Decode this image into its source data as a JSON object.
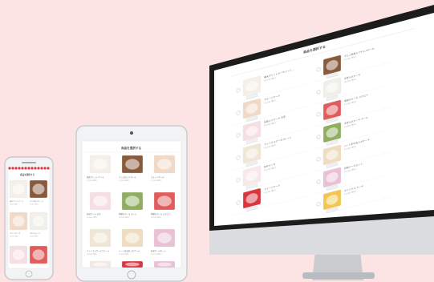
{
  "screen_title": "商品を選択する",
  "products": {
    "left": [
      {
        "name": "楽天プリントケーキラージ…",
        "price": "¥3,500 (税込)",
        "icon": "photo-cake-icon",
        "color": "#f4efe8"
      },
      {
        "name": "フルーツケーキ",
        "price": "¥3,200 (税込)",
        "icon": "fruit-cake-icon",
        "color": "#f0d9c6"
      },
      {
        "name": "名前入りケーキ 文字",
        "price": "¥3,000 (税込)",
        "icon": "letter-cake-icon",
        "color": "#f6dfe3"
      },
      {
        "name": "ファイナルケーキプレート",
        "price": "¥3,500 (税込)",
        "icon": "plate-cake-icon",
        "color": "#efe6d6"
      },
      {
        "name": "新作ケーキ",
        "price": "¥3,200 (税込)",
        "icon": "new-cake-icon",
        "color": "#f7e9e9"
      },
      {
        "name": "スイーツケーキ",
        "price": "¥3,500 (税込)",
        "icon": "rose-cake-icon",
        "color": "#d9363e"
      }
    ],
    "right": [
      {
        "name": "チョコ名前入りチョコケーキ",
        "price": "¥3,500 (税込)",
        "icon": "chocolate-cake-icon",
        "color": "#8a5a3c"
      },
      {
        "name": "文字入れケーキ",
        "price": "¥3,200 (税込)",
        "icon": "bear-cake-icon",
        "color": "#f1efe9"
      },
      {
        "name": "季節のケーキ スクエア",
        "price": "¥3,500 (税込)",
        "icon": "square-cake-icon",
        "color": "#e35c5c"
      },
      {
        "name": "文字入れケーキ ホール",
        "price": "¥3,500 (税込)",
        "icon": "frame-cake-icon",
        "color": "#8fae5f"
      },
      {
        "name": "ハート形の名入れケーキ",
        "price": "¥3,500 (税込)",
        "icon": "heart-cake-icon",
        "color": "#f0dcc0"
      },
      {
        "name": "名前ケーキセット",
        "price": "¥3,200 (税込)",
        "icon": "gift-box-icon",
        "color": "#e9c0d4"
      },
      {
        "name": "オリジナル ケーキ",
        "price": "¥3,500 (税込)",
        "icon": "rainbow-cake-icon",
        "color": "#f3c74f"
      }
    ]
  },
  "phone_items": [
    {
      "name": "楽天プリントケーキ",
      "price": "¥3,500 (税込)"
    },
    {
      "name": "チョコ名入りケーキ",
      "price": "¥3,500 (税込)"
    },
    {
      "name": "フルーツケーキ",
      "price": "¥3,200 (税込)"
    },
    {
      "name": "文字入れケーキ",
      "price": "¥3,200 (税込)"
    }
  ],
  "tablet_items": [
    {
      "name": "楽天プリントケーキ",
      "price": "¥3,500 (税込)"
    },
    {
      "name": "チョコ名入りケーキ",
      "price": "¥3,500 (税込)"
    },
    {
      "name": "フルーツケーキ",
      "price": "¥3,200 (税込)"
    },
    {
      "name": "名前ケーキ 文字",
      "price": "¥3,000 (税込)"
    },
    {
      "name": "季節のケーキ ホール",
      "price": "¥3,500 (税込)"
    },
    {
      "name": "季節のケーキ スクエア",
      "price": "¥3,500 (税込)"
    },
    {
      "name": "ファイナルケーキプレート",
      "price": "¥3,500 (税込)"
    },
    {
      "name": "ハート形の名入れケーキ",
      "price": "¥3,500 (税込)"
    },
    {
      "name": "名前ケーキセット",
      "price": "¥3,200 (税込)"
    }
  ],
  "colors": {
    "background": "#fde4e4",
    "device_frame": "#1c1c1c",
    "device_silver": "#d5d7db",
    "screen": "#ffffff",
    "accent": "#d9363e"
  }
}
